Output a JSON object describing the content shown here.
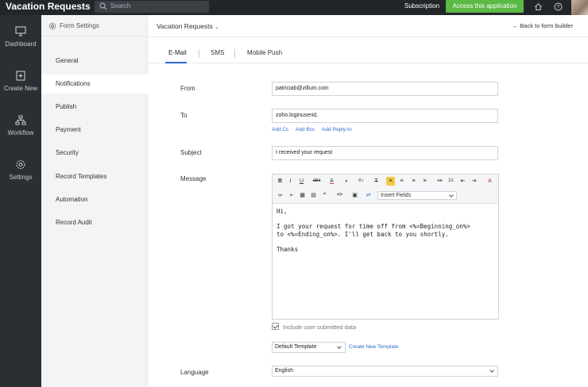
{
  "app": {
    "title": "Vacation Requests"
  },
  "topbar": {
    "search_placeholder": "Search",
    "subscription_label": "Subscription",
    "access_button_label": "Access this application",
    "icons": [
      "home-icon",
      "help-icon"
    ]
  },
  "rail": {
    "items": [
      {
        "label": "Dashboard",
        "icon": "monitor-icon"
      },
      {
        "label": "Create New",
        "icon": "create-new-icon"
      },
      {
        "label": "Workflow",
        "icon": "workflow-icon"
      },
      {
        "label": "Settings",
        "icon": "gear-icon"
      }
    ]
  },
  "sidebar": {
    "header": "Form Settings",
    "items": [
      {
        "label": "General"
      },
      {
        "label": "Notifications",
        "active": true
      },
      {
        "label": "Publish"
      },
      {
        "label": "Payment"
      },
      {
        "label": "Security"
      },
      {
        "label": "Record Templates"
      },
      {
        "label": "Automation"
      },
      {
        "label": "Record Audit"
      }
    ]
  },
  "main": {
    "breadcrumb": "Vacation Requests",
    "back_link": "Back to form builder",
    "tabs": [
      {
        "label": "E-Mail",
        "active": true
      },
      {
        "label": "SMS"
      },
      {
        "label": "Mobile Push"
      }
    ]
  },
  "form": {
    "from": {
      "label": "From",
      "value": "patriciab@zillum.com"
    },
    "to": {
      "label": "To",
      "value": "zoho.loginuserid,"
    },
    "to_links": {
      "add_cc": "Add Cc",
      "add_bcc": "Add Bcc",
      "add_reply_to": "Add Reply-to"
    },
    "subject": {
      "label": "Subject",
      "value": "I received your request"
    },
    "message": {
      "label": "Message",
      "insert_fields": "Insert Fields",
      "lines": [
        "Hi,",
        "I got your request for time off from <%=Beginning_on%>",
        "to <%=Ending_on%>. I'll get back to you shortly.",
        "Thanks"
      ]
    },
    "include_data": {
      "label": "Include user submitted data",
      "checked": true
    },
    "template": {
      "selected": "Default Template",
      "create_link": "Create New Template"
    },
    "language": {
      "label": "Language",
      "selected": "English"
    }
  },
  "colors": {
    "accent_green": "#5cb945",
    "link_blue": "#2d6bcf",
    "highlight": "#f5c842",
    "topbar": "#232629"
  }
}
